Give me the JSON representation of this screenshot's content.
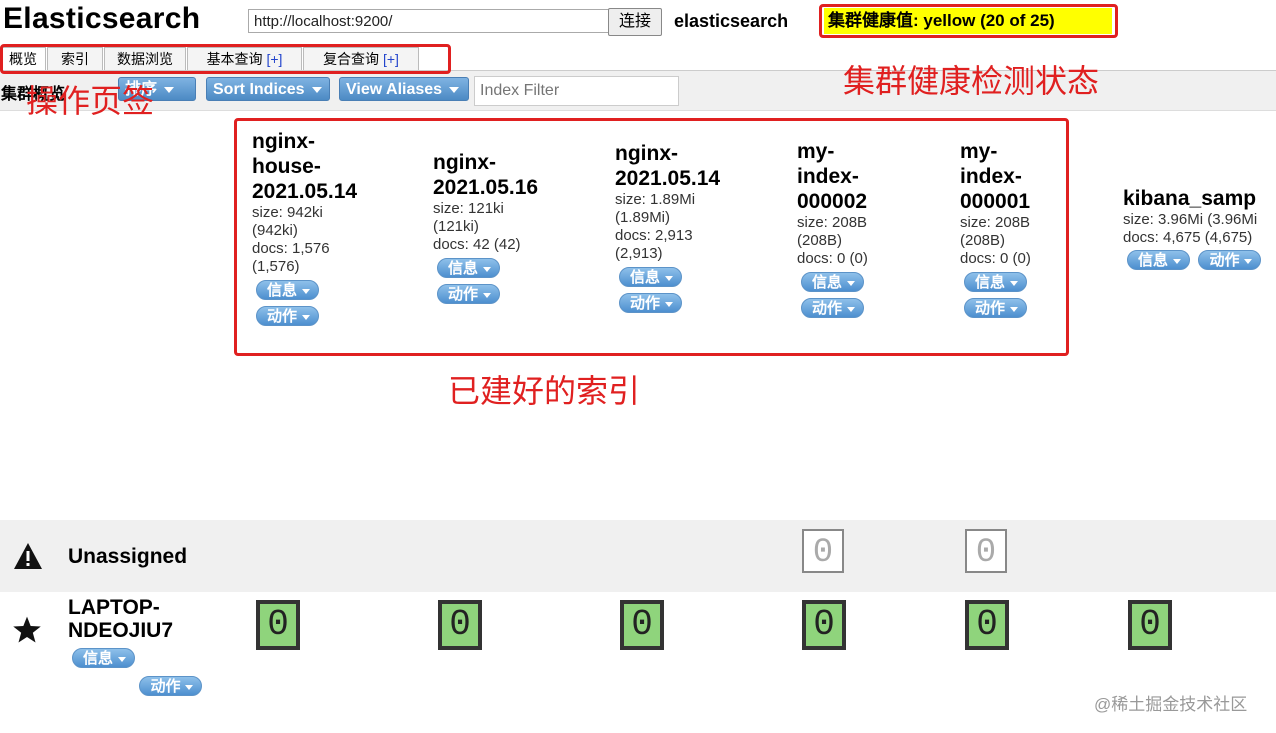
{
  "header": {
    "app_title": "Elasticsearch",
    "url_value": "http://localhost:9200/",
    "connect_label": "连接",
    "cluster_name": "elasticsearch",
    "health_status": "集群健康值: yellow (20 of 25)",
    "health_color": "#ffff00"
  },
  "tabs": [
    {
      "label": "概览",
      "plus": ""
    },
    {
      "label": "索引",
      "plus": ""
    },
    {
      "label": "数据浏览",
      "plus": ""
    },
    {
      "label": "基本查询",
      "plus": "[+]"
    },
    {
      "label": "复合查询",
      "plus": "[+]"
    }
  ],
  "toolbar": {
    "section_label": "集群概览",
    "sort_button_label": "排序",
    "sort_indices_label": "Sort Indices",
    "view_aliases_label": "View Aliases",
    "index_filter_placeholder": "Index Filter"
  },
  "indices": [
    {
      "name": "nginx-\nhouse-\n2021.05.14",
      "size": "size: 942ki\n(942ki)",
      "docs": "docs: 1,576\n(1,576)"
    },
    {
      "name": "nginx-\n2021.05.16",
      "size": "size: 121ki\n(121ki)",
      "docs": "docs: 42 (42)"
    },
    {
      "name": "nginx-\n2021.05.14",
      "size": "size: 1.89Mi\n(1.89Mi)",
      "docs": "docs: 2,913\n(2,913)"
    },
    {
      "name": "my-\nindex-\n000002",
      "size": "size: 208B\n(208B)",
      "docs": "docs: 0 (0)"
    },
    {
      "name": "my-\nindex-\n000001",
      "size": "size: 208B\n(208B)",
      "docs": "docs: 0 (0)"
    },
    {
      "name": "kibana_samp",
      "size": "size: 3.96Mi (3.96Mi",
      "docs": "docs: 4,675 (4,675)"
    }
  ],
  "index_buttons": {
    "info_label": "信息",
    "action_label": "动作"
  },
  "rows": {
    "unassigned_label": "Unassigned",
    "node_label": "LAPTOP-\nNDEOJIU7"
  },
  "shards": {
    "unassigned": [
      "0",
      "0"
    ],
    "node": [
      "0",
      "0",
      "0",
      "0",
      "0",
      "0"
    ],
    "assigned_color": "#8fd47c"
  },
  "annotations": {
    "tabs_note": "操作页签",
    "health_note": "集群健康检测状态",
    "indices_note": "已建好的索引",
    "color": "#e02020"
  },
  "watermark": "@稀土掘金技术社区"
}
